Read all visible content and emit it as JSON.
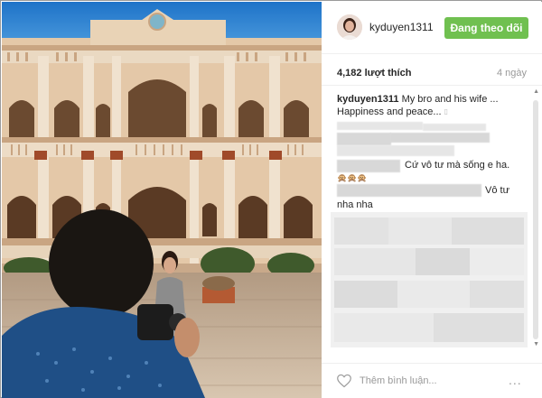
{
  "post": {
    "username": "kyduyen1311",
    "follow_button": "Đang theo dõi",
    "likes": "4,182 lượt thích",
    "time_ago": "4 ngày",
    "caption": {
      "username": "kyduyen1311",
      "text_line1": "My bro and his wife ...",
      "text_line2": "Happiness and peace..."
    },
    "comments": [
      {
        "text": "Cứ vô tư mà sống e ha."
      },
      {
        "text": "🙊🙊🙊"
      },
      {
        "text": "Vô tư"
      },
      {
        "text": "nha nha"
      }
    ]
  },
  "footer": {
    "add_comment_placeholder": "Thêm bình luận...",
    "more_label": "..."
  },
  "colors": {
    "follow_button_bg": "#70c050",
    "text_primary": "#262626",
    "text_secondary": "#999999"
  },
  "icons": {
    "heart": "heart-outline-icon",
    "more": "ellipsis-icon"
  }
}
